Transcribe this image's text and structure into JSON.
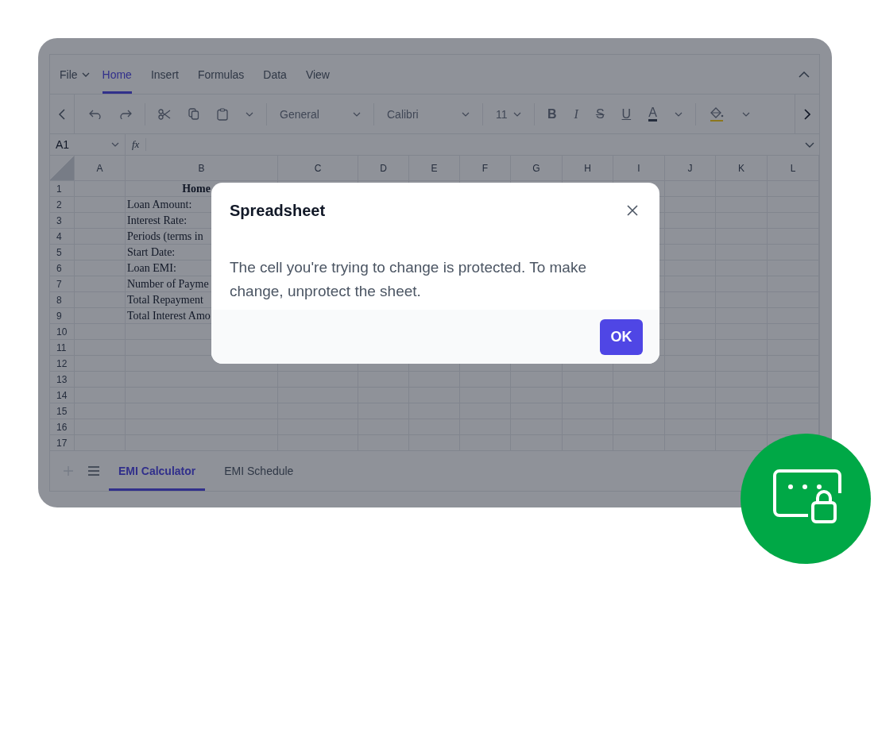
{
  "ribbon": {
    "file_menu": "File",
    "tabs": [
      {
        "label": "Home",
        "selected": true
      },
      {
        "label": "Insert",
        "selected": false
      },
      {
        "label": "Formulas",
        "selected": false
      },
      {
        "label": "Data",
        "selected": false
      },
      {
        "label": "View",
        "selected": false
      }
    ]
  },
  "toolbar": {
    "number_format": "General",
    "font_name": "Calibri",
    "font_size": "11",
    "format_buttons": [
      "B",
      "I",
      "S",
      "U"
    ],
    "font_color": "A"
  },
  "formula_bar": {
    "name_box": "A1",
    "function_label": "fx"
  },
  "grid": {
    "columns": [
      "A",
      "B",
      "C",
      "D",
      "E",
      "F",
      "G",
      "H",
      "I",
      "J",
      "K",
      "L"
    ],
    "rows": [
      {
        "label": "1",
        "b": "Home",
        "kind": "title"
      },
      {
        "label": "2",
        "b": "Loan Amount:"
      },
      {
        "label": "3",
        "b": "Interest Rate:"
      },
      {
        "label": "4",
        "b": "Periods (terms in"
      },
      {
        "label": "5",
        "b": "Start Date:"
      },
      {
        "label": "6",
        "b": "Loan EMI:"
      },
      {
        "label": "7",
        "b": "Number of Payme"
      },
      {
        "label": "8",
        "b": "Total Repayment"
      },
      {
        "label": "9",
        "b": "Total Interest Amo"
      },
      {
        "label": "10"
      },
      {
        "label": "11"
      },
      {
        "label": "12"
      },
      {
        "label": "13"
      },
      {
        "label": "14"
      },
      {
        "label": "15"
      },
      {
        "label": "16"
      },
      {
        "label": "17"
      }
    ]
  },
  "sheet_tabs": [
    {
      "label": "EMI Calculator",
      "selected": true
    },
    {
      "label": "EMI Schedule",
      "selected": false
    }
  ],
  "dialog": {
    "title": "Spreadsheet",
    "message": "The cell you're trying to change is protected. To make change, unprotect the sheet.",
    "button": "OK"
  }
}
